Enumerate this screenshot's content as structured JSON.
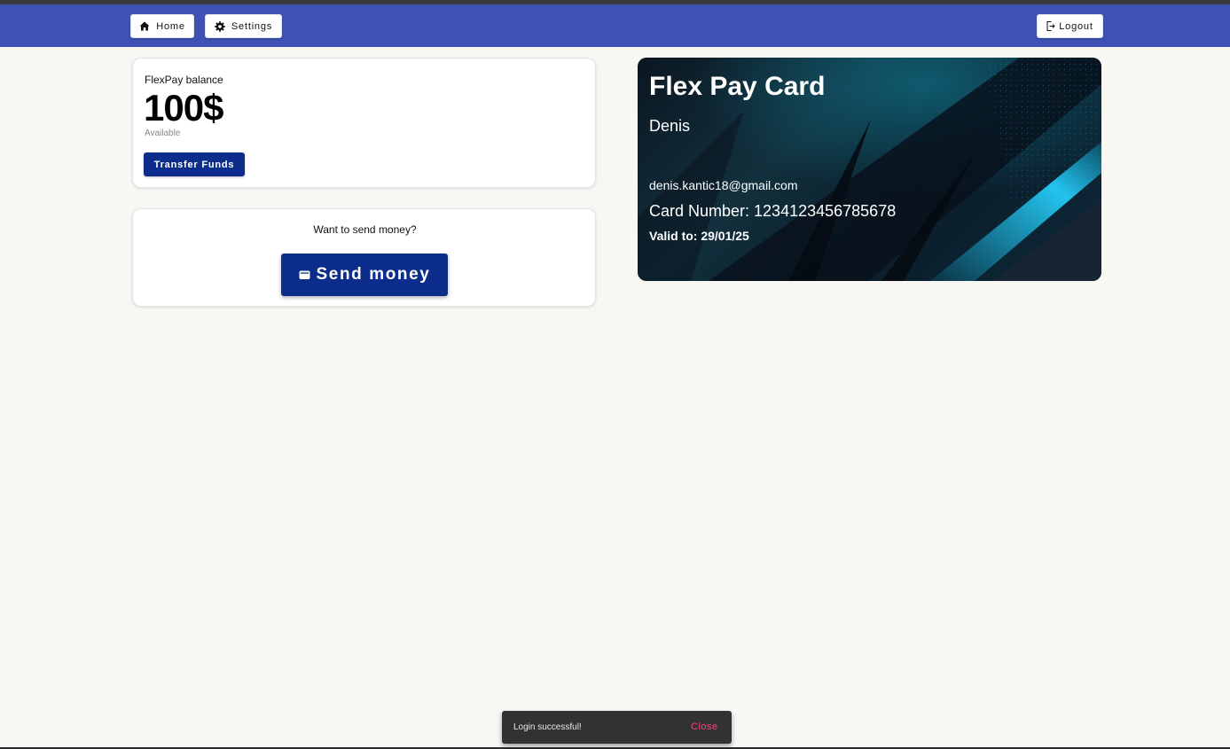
{
  "navbar": {
    "home_label": "Home",
    "settings_label": "Settings",
    "logout_label": "Logout",
    "color": "#3f51b5"
  },
  "balance": {
    "label": "FlexPay balance",
    "amount": "100$",
    "sub": "Available",
    "transfer_label": "Transfer Funds"
  },
  "send": {
    "question": "Want to send money?",
    "button_label": "Send money"
  },
  "card": {
    "title": "Flex Pay Card",
    "name": "Denis",
    "email": "denis.kantic18@gmail.com",
    "number": "Card Number: 1234123456785678",
    "valid": "Valid to: 29/01/25"
  },
  "snackbar": {
    "message": "Login successful!",
    "close_label": "Close"
  },
  "colors": {
    "primary_button": "#0c2d8c",
    "accent": "#ff4081"
  }
}
